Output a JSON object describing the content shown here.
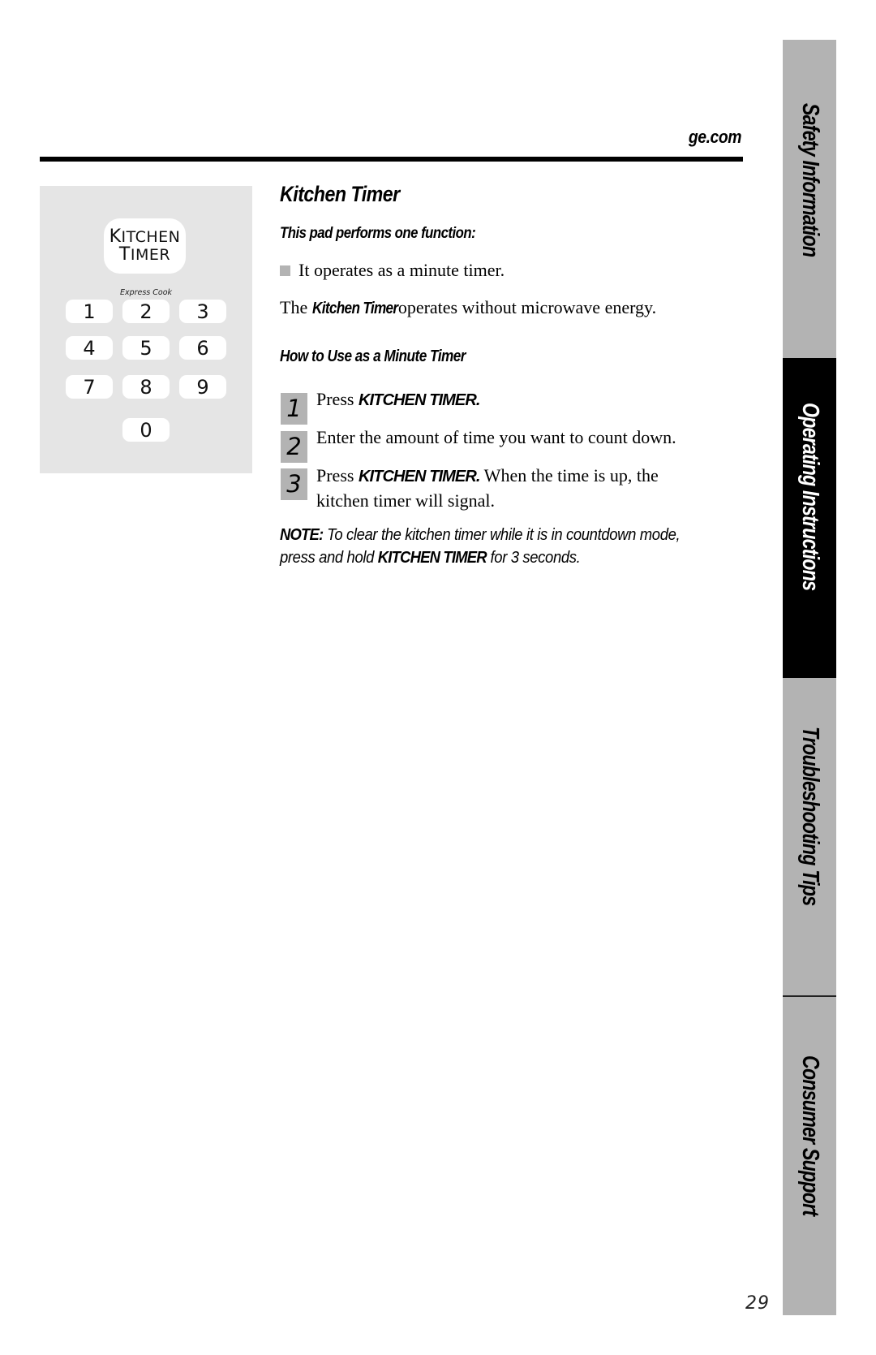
{
  "header": {
    "site_url": "ge.com"
  },
  "keypad": {
    "kitchen_timer_key": {
      "line1_initial": "K",
      "line1_rest": "ITCHEN",
      "line2_initial": "T",
      "line2_rest": "IMER"
    },
    "express_cook_label": "Express Cook",
    "number_keys": [
      "1",
      "2",
      "3",
      "4",
      "5",
      "6",
      "7",
      "8",
      "9",
      "0"
    ]
  },
  "content": {
    "title": "Kitchen Timer",
    "subtitle": "This pad performs one function:",
    "bullets": [
      "It operates as a minute timer."
    ],
    "intro": {
      "prefix": "The ",
      "emphasis": "Kitchen Timer",
      "suffix": " operates without microwave energy."
    },
    "howto_heading": "How to Use as a Minute Timer",
    "steps": [
      {
        "number": "1",
        "prefix": "Press ",
        "emphasis": "KITCHEN TIMER.",
        "suffix": ""
      },
      {
        "number": "2",
        "prefix": "Enter the amount of time you want to count down.",
        "emphasis": "",
        "suffix": ""
      },
      {
        "number": "3",
        "prefix": "Press ",
        "emphasis": "KITCHEN TIMER.",
        "suffix": " When the time is up, the",
        "line2": "kitchen timer will signal."
      }
    ],
    "note": {
      "label": "NOTE:",
      "text1": " To clear the kitchen timer while it is in countdown mode, press and hold ",
      "emphasis": "KITCHEN TIMER",
      "text2": " for 3 seconds."
    }
  },
  "side_tabs": [
    {
      "label": "Safety Information",
      "active": false
    },
    {
      "label": "Operating Instructions",
      "active": true
    },
    {
      "label": "Troubleshooting Tips",
      "active": false
    },
    {
      "label": "Consumer Support",
      "active": false
    }
  ],
  "page_number": "29",
  "colors": {
    "tab_gray": "#b3b3b3",
    "tab_active": "#000000",
    "panel_gray": "#e5e5e5",
    "step_box_gray": "#b3b3b3"
  }
}
